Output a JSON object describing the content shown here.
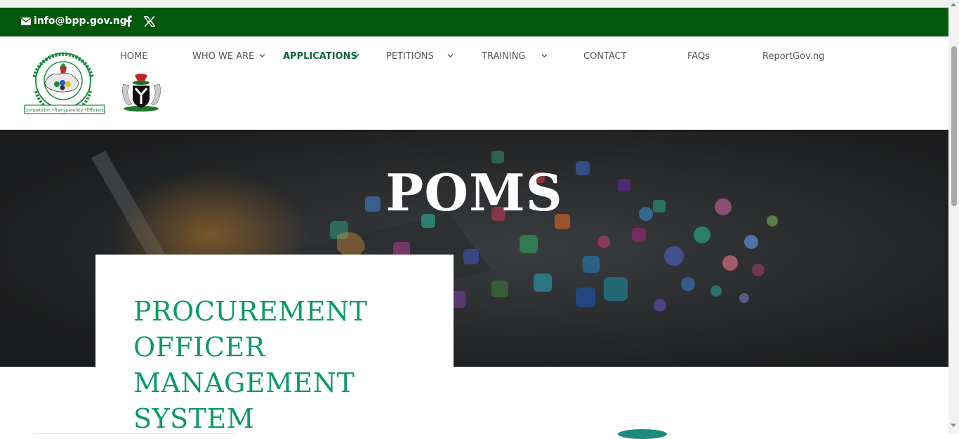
{
  "topbar": {
    "email": "info@bpp.gov.ng",
    "email_icon": "envelope-icon",
    "social": [
      {
        "name": "facebook",
        "icon": "facebook-icon"
      },
      {
        "name": "x",
        "icon": "x-icon"
      }
    ],
    "bg_color": "#03580c"
  },
  "logos": {
    "bpp": {
      "ring_text": "BUREAU OF PUBLIC PROCUREMENT",
      "motto": "*Competition *Transparency *Efficiency"
    },
    "coat_of_arms": "nigeria-coat-of-arms"
  },
  "nav": {
    "items": [
      {
        "label": "HOME",
        "dropdown": false
      },
      {
        "label": "WHO WE ARE",
        "dropdown": true
      },
      {
        "label": "APPLICATIONS",
        "dropdown": true,
        "active": true
      },
      {
        "label": "PETITIONS",
        "dropdown": true
      },
      {
        "label": "TRAINING",
        "dropdown": true
      },
      {
        "label": "CONTACT",
        "dropdown": false
      },
      {
        "label": "FAQs",
        "dropdown": false
      },
      {
        "label": "ReportGov.ng",
        "dropdown": false
      }
    ],
    "active_color": "#10653a"
  },
  "hero": {
    "title": "POMS"
  },
  "card": {
    "title_lines": [
      "PROCUREMENT",
      "OFFICER",
      "MANAGEMENT",
      "SYSTEM"
    ],
    "title_color": "#0d9a64"
  }
}
